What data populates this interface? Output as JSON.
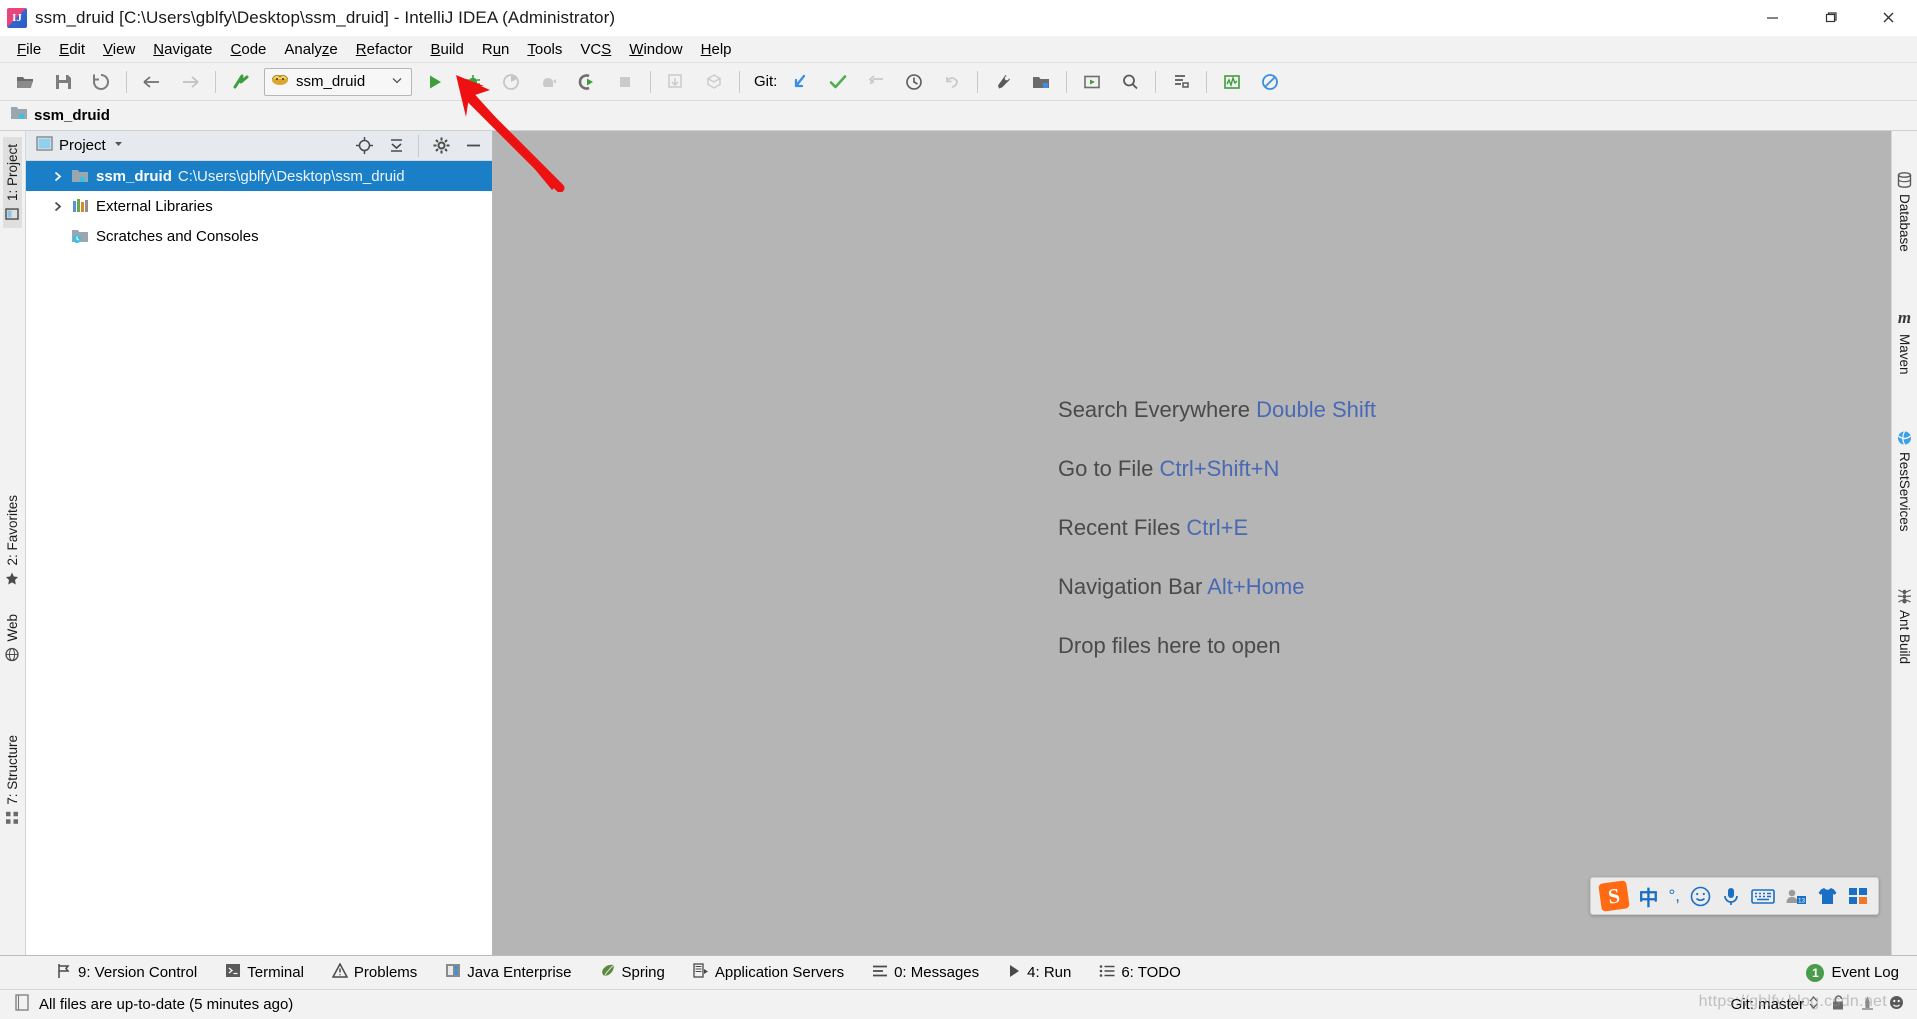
{
  "window": {
    "title": "ssm_druid [C:\\Users\\gblfy\\Desktop\\ssm_druid] - IntelliJ IDEA (Administrator)",
    "app_icon": "intellij-idea-icon",
    "minimize_label": "Minimize",
    "maximize_label": "Restore",
    "close_label": "Close"
  },
  "menubar": {
    "items": [
      {
        "label": "File",
        "mnemonic": "F"
      },
      {
        "label": "Edit",
        "mnemonic": "E"
      },
      {
        "label": "View",
        "mnemonic": "V"
      },
      {
        "label": "Navigate",
        "mnemonic": "N"
      },
      {
        "label": "Code",
        "mnemonic": "C"
      },
      {
        "label": "Analyze",
        "mnemonic": "z"
      },
      {
        "label": "Refactor",
        "mnemonic": "R"
      },
      {
        "label": "Build",
        "mnemonic": "B"
      },
      {
        "label": "Run",
        "mnemonic": "u"
      },
      {
        "label": "Tools",
        "mnemonic": "T"
      },
      {
        "label": "VCS",
        "mnemonic": "S"
      },
      {
        "label": "Window",
        "mnemonic": "W"
      },
      {
        "label": "Help",
        "mnemonic": "H"
      }
    ]
  },
  "toolbar": {
    "open_label": "Open",
    "save_all_label": "Save All",
    "sync_label": "Synchronize",
    "back_label": "Back",
    "forward_label": "Forward",
    "build_label": "Build Project",
    "run_config_name": "ssm_druid",
    "run_config_icon": "tomcat-icon",
    "run_label": "Run",
    "debug_label": "Debug",
    "run_with_coverage_label": "Run with Coverage",
    "profile_label": "Profile",
    "attach_label": "Attach to Process",
    "stop_label": "Stop",
    "update_project_label": "Update Project",
    "commit_label": "Commit",
    "git_label": "Git:",
    "git_update_label": "Update Project",
    "git_commit_label": "Commit",
    "git_push_label": "Push",
    "git_history_label": "Show History",
    "git_revert_label": "Revert",
    "settings_label": "Settings",
    "project_structure_label": "Project Structure",
    "select_run_label": "Select Run/Debug Configuration",
    "search_label": "Search Everywhere",
    "structure_label": "Structure",
    "monitor_label": "Performance Monitor",
    "no_access_label": "Disable Inspection"
  },
  "navbar": {
    "project_name": "ssm_druid",
    "icon": "module-folder-icon"
  },
  "left_tool_strip": {
    "items": [
      {
        "label": "1: Project",
        "icon": "project-icon",
        "active": true
      },
      {
        "label": "2: Favorites",
        "icon": "star-icon",
        "active": false
      },
      {
        "label": "Web",
        "icon": "globe-icon",
        "active": false
      },
      {
        "label": "7: Structure",
        "icon": "structure-icon",
        "active": false
      }
    ]
  },
  "right_tool_strip": {
    "items": [
      {
        "label": "Database",
        "icon": "database-icon"
      },
      {
        "label": "Maven",
        "icon": "maven-icon"
      },
      {
        "label": "RestServices",
        "icon": "rest-services-icon"
      },
      {
        "label": "Ant Build",
        "icon": "ant-build-icon"
      }
    ]
  },
  "project_pane": {
    "title": "Project",
    "title_icon": "project-view-icon",
    "dropdown_icon": "chevron-down-icon",
    "locate_label": "Select Opened File",
    "collapse_label": "Collapse All",
    "settings_label": "Show Options Menu",
    "hide_label": "Hide",
    "tree": [
      {
        "name": "ssm_druid",
        "path": "C:\\Users\\gblfy\\Desktop\\ssm_druid",
        "icon": "module-folder-icon",
        "expandable": true,
        "selected": true,
        "indent": 0
      },
      {
        "name": "External Libraries",
        "path": "",
        "icon": "libraries-icon",
        "expandable": true,
        "selected": false,
        "indent": 0
      },
      {
        "name": "Scratches and Consoles",
        "path": "",
        "icon": "scratches-icon",
        "expandable": false,
        "selected": false,
        "indent": 0
      }
    ]
  },
  "editor": {
    "tips": [
      {
        "action": "Search Everywhere",
        "shortcut": "Double Shift"
      },
      {
        "action": "Go to File",
        "shortcut": "Ctrl+Shift+N"
      },
      {
        "action": "Recent Files",
        "shortcut": "Ctrl+E"
      },
      {
        "action": "Navigation Bar",
        "shortcut": "Alt+Home"
      },
      {
        "action": "Drop files here to open",
        "shortcut": ""
      }
    ]
  },
  "ime_bar": {
    "logo": "sogou-logo-icon",
    "logo_text": "S",
    "items": [
      {
        "icon": "chinese-mode-icon",
        "label": "中"
      },
      {
        "icon": "punctuation-icon",
        "label": "°,"
      },
      {
        "icon": "emoji-icon",
        "label": "☺"
      },
      {
        "icon": "microphone-icon",
        "label": "Voice Input"
      },
      {
        "icon": "soft-keyboard-icon",
        "label": "Soft Keyboard"
      },
      {
        "icon": "user-card-icon",
        "label": "User"
      },
      {
        "icon": "skin-icon",
        "label": "Skin"
      },
      {
        "icon": "toolbox-icon",
        "label": "Toolbox"
      }
    ]
  },
  "bottom_bar": {
    "items": [
      {
        "label": "9: Version Control",
        "mnemonic": "9",
        "icon": "version-control-icon"
      },
      {
        "label": "Terminal",
        "mnemonic": "",
        "icon": "terminal-icon"
      },
      {
        "label": "Problems",
        "mnemonic": "",
        "icon": "problems-icon"
      },
      {
        "label": "Java Enterprise",
        "mnemonic": "",
        "icon": "java-enterprise-icon"
      },
      {
        "label": "Spring",
        "mnemonic": "",
        "icon": "spring-icon"
      },
      {
        "label": "Application Servers",
        "mnemonic": "",
        "icon": "application-servers-icon"
      },
      {
        "label": "0: Messages",
        "mnemonic": "0",
        "icon": "messages-icon"
      },
      {
        "label": "4: Run",
        "mnemonic": "4",
        "icon": "run-icon"
      },
      {
        "label": "6: TODO",
        "mnemonic": "6",
        "icon": "todo-icon"
      }
    ],
    "event_log_label": "Event Log",
    "event_log_count": "1"
  },
  "statusbar": {
    "message": "All files are up-to-date (5 minutes ago)",
    "message_icon": "file-sync-icon",
    "git_branch": "Git: master",
    "lock_icon": "unlocked-icon",
    "inspection_icon": "inspection-icon",
    "notifications_icon": "notifications-icon",
    "watermark": "https://gblfy.blog.csdn.net"
  },
  "annotation": {
    "arrow": "red-arrow-pointing-to-run-button",
    "color": "#ee1111"
  },
  "colors": {
    "accent_blue": "#1a7fc7",
    "link_blue": "#4a69b5",
    "editor_bg": "#b5b5b5",
    "chrome_bg": "#f2f2f2",
    "green_run": "#3e9e3e"
  }
}
